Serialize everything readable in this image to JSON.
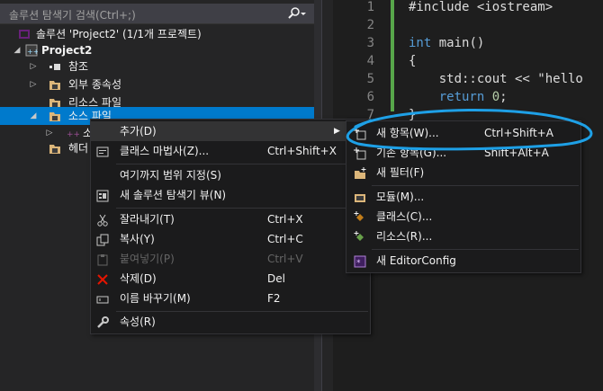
{
  "solution_explorer": {
    "search_placeholder": "솔루션 탐색기 검색(Ctrl+;)",
    "tree": [
      {
        "label": "솔루션 'Project2' (1/1개 프로젝트)"
      },
      {
        "label": "Project2"
      },
      {
        "label": "참조"
      },
      {
        "label": "외부 종속성"
      },
      {
        "label": "리소스 파일"
      },
      {
        "label": "소스 파일"
      },
      {
        "label": "소"
      },
      {
        "label": "헤더"
      }
    ]
  },
  "editor": {
    "line_numbers": [
      "1",
      "2",
      "3",
      "4",
      "5",
      "6",
      "7"
    ],
    "lines": [
      {
        "a": "#include <iostream>"
      },
      {
        "a": ""
      },
      {
        "kw": "int",
        "b": " main()"
      },
      {
        "a": "{"
      },
      {
        "a": "    std::cout << \"hello"
      },
      {
        "kw2": "    return",
        "num": " 0",
        "a2": ";"
      },
      {
        "a": "}"
      }
    ]
  },
  "context_menu": {
    "items": [
      {
        "label": "추가(D)",
        "shortcut": ""
      },
      {
        "label": "클래스 마법사(Z)...",
        "shortcut": "Ctrl+Shift+X"
      },
      {
        "label": "여기까지 범위 지정(S)",
        "shortcut": ""
      },
      {
        "label": "새 솔루션 탐색기 뷰(N)",
        "shortcut": ""
      },
      {
        "label": "잘라내기(T)",
        "shortcut": "Ctrl+X"
      },
      {
        "label": "복사(Y)",
        "shortcut": "Ctrl+C"
      },
      {
        "label": "붙여넣기(P)",
        "shortcut": "Ctrl+V"
      },
      {
        "label": "삭제(D)",
        "shortcut": "Del"
      },
      {
        "label": "이름 바꾸기(M)",
        "shortcut": "F2"
      },
      {
        "label": "속성(R)",
        "shortcut": ""
      }
    ]
  },
  "submenu": {
    "items": [
      {
        "label": "새 항목(W)...",
        "shortcut": "Ctrl+Shift+A"
      },
      {
        "label": "기존 항목(G)...",
        "shortcut": "Shift+Alt+A"
      },
      {
        "label": "새 필터(F)",
        "shortcut": ""
      },
      {
        "label": "모듈(M)...",
        "shortcut": ""
      },
      {
        "label": "클래스(C)...",
        "shortcut": ""
      },
      {
        "label": "리소스(R)...",
        "shortcut": ""
      },
      {
        "label": "새 EditorConfig",
        "shortcut": ""
      }
    ]
  },
  "colors": {
    "selection": "#007acc",
    "annotation": "#1ea0e6",
    "accent_green": "#57a64a"
  }
}
